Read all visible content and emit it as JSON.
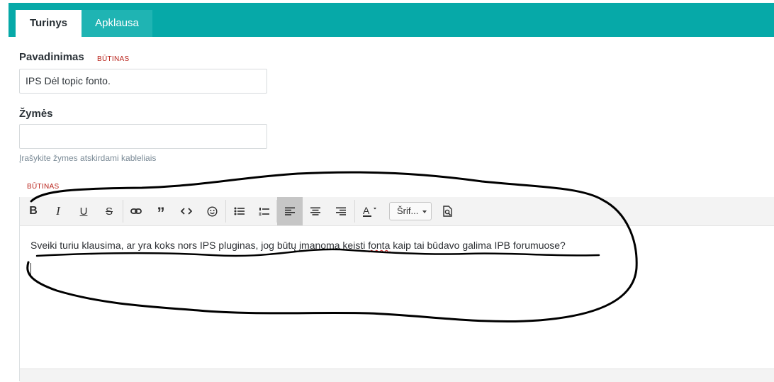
{
  "tabs": [
    {
      "label": "Turinys",
      "active": true
    },
    {
      "label": "Apklausa",
      "active": false
    }
  ],
  "form": {
    "title_label": "Pavadinimas",
    "required_label": "BŪTINAS",
    "title_value": "IPS Dėl topic fonto.",
    "tags_label": "Žymės",
    "tags_value": "",
    "tags_hint": "Įrašykite žymes atskirdami kableliais",
    "content_required_label": "BŪTINAS"
  },
  "editor": {
    "font_select_label": "Šrif...",
    "text_before": "Sveiki turiu klausima, ar yra koks nors IPS pluginas, jog būtų įmanoma keisti ",
    "text_misspelled": "fonta",
    "text_after": " kaip tai būdavo galima IPB forumuose?"
  },
  "colors": {
    "tab_bar": "#06a9a8",
    "required": "#b81f17",
    "annotation": "#000000"
  },
  "icons": [
    "bold-icon",
    "italic-icon",
    "underline-icon",
    "strikethrough-icon",
    "link-icon",
    "quote-icon",
    "code-icon",
    "emoji-icon",
    "bulleted-list-icon",
    "numbered-list-icon",
    "align-left-icon",
    "align-center-icon",
    "align-right-icon",
    "text-color-icon",
    "preview-icon"
  ]
}
